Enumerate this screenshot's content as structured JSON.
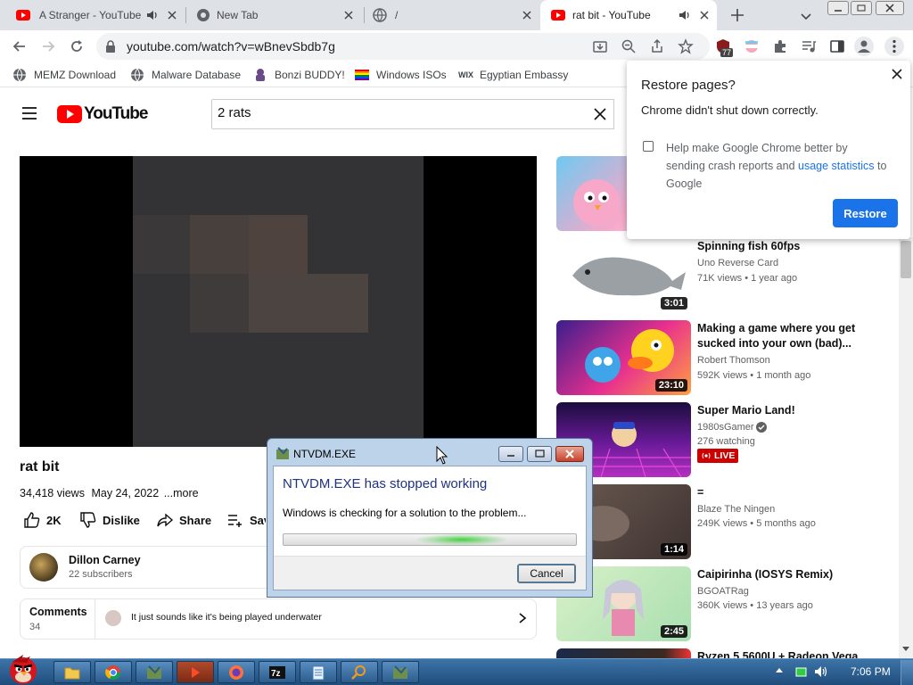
{
  "tabs": [
    {
      "title": "A Stranger - YouTube"
    },
    {
      "title": "New Tab"
    },
    {
      "title": "/"
    },
    {
      "title": "rat bit - YouTube"
    }
  ],
  "toolbar": {
    "url": "youtube.com/watch?v=wBnevSbdb7g",
    "extension_badge": "77"
  },
  "bookmarks": [
    {
      "label": "MEMZ Download"
    },
    {
      "label": "Malware Database"
    },
    {
      "label": "Bonzi BUDDY!"
    },
    {
      "label": "Windows ISOs"
    },
    {
      "label": "Egyptian Embassy"
    }
  ],
  "youtube": {
    "logo": "YouTube",
    "search_query": "2 rats",
    "video": {
      "title": "rat bit",
      "views": "34,418 views",
      "date": "May 24, 2022",
      "more": "...more",
      "likes": "2K",
      "dislike_label": "Dislike",
      "share_label": "Share",
      "save_label": "Save"
    },
    "channel": {
      "name": "Dillon Carney",
      "subscribers": "22 subscribers"
    },
    "comments": {
      "label": "Comments",
      "count": "34",
      "top_comment": "It just sounds like it's being played underwater"
    },
    "recommended": [
      {
        "title": "Spinning fish 60fps",
        "channel": "Uno Reverse Card",
        "meta": "71K views • 1 year ago",
        "duration": "3:01"
      },
      {
        "title": "Making a game where you get sucked into your own (bad)...",
        "channel": "Robert Thomson",
        "meta": "592K views • 1 month ago",
        "duration": "23:10"
      },
      {
        "title": "Super Mario Land!",
        "channel": "1980sGamer",
        "meta": "276 watching",
        "live": "LIVE"
      },
      {
        "title": "=",
        "channel": "Blaze The Ningen",
        "meta": "249K views • 5 months ago",
        "duration": "1:14"
      },
      {
        "title": "Caipirinha (IOSYS Remix)",
        "channel": "BGOATRag",
        "meta": "360K views • 13 years ago",
        "duration": "2:45"
      },
      {
        "title": "Ryzen 5 5600U + Radeon Vega"
      }
    ]
  },
  "restore_popup": {
    "title": "Restore pages?",
    "message": "Chrome didn't shut down correctly.",
    "checkbox_prefix": "Help make Google Chrome better by sending crash reports and",
    "checkbox_link": "usage statistics",
    "checkbox_suffix": "to Google",
    "button": "Restore"
  },
  "dialog": {
    "title": "NTVDM.EXE",
    "heading": "NTVDM.EXE has stopped working",
    "message": "Windows is checking for a solution to the problem...",
    "cancel": "Cancel"
  },
  "taskbar": {
    "clock": "7:06 PM"
  },
  "colors": {
    "youtube_red": "#ff0000",
    "chrome_blue": "#1a73e8",
    "live_red": "#cc0000"
  }
}
